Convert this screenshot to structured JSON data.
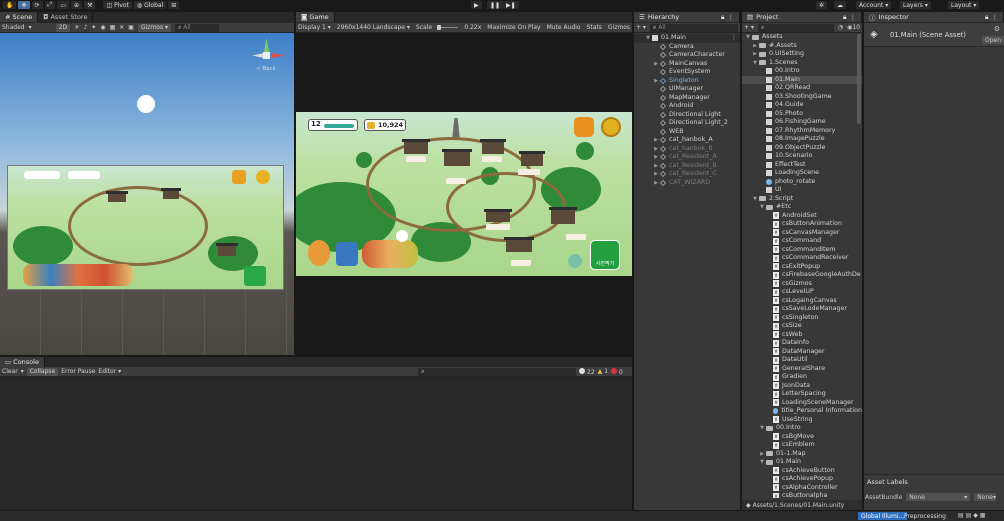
{
  "toolbar": {
    "pivot": "Pivot",
    "global": "Global",
    "account": "Account",
    "layers": "Layers",
    "layout": "Layout"
  },
  "scene_panel": {
    "tabs": [
      "Scene",
      "Asset Store"
    ],
    "shading": "Shaded",
    "mode_2d": "2D",
    "gizmos": "Gizmos",
    "search_placeholder": "All",
    "gizmo_label": "< Back"
  },
  "game_panel": {
    "tab": "Game",
    "display": "Display 1",
    "resolution": "2960x1440 Landscape",
    "scale_label": "Scale",
    "scale_value": "0.22x",
    "maximize": "Maximize On Play",
    "mute": "Mute Audio",
    "stats": "Stats",
    "gizmos": "Gizmos",
    "hud": {
      "level": "12",
      "gold": "10,924",
      "button": "사진찍기"
    }
  },
  "hierarchy": {
    "tab": "Hierarchy",
    "search_placeholder": "All",
    "root": "01.Main",
    "items": [
      {
        "label": "Camera",
        "dim": false,
        "expand": false
      },
      {
        "label": "CameraCharacter",
        "dim": false,
        "expand": false
      },
      {
        "label": "MainCanvas",
        "dim": false,
        "expand": true
      },
      {
        "label": "EventSystem",
        "dim": false,
        "expand": false
      },
      {
        "label": "Singleton",
        "dim": false,
        "expand": true,
        "blue": true
      },
      {
        "label": "UIManager",
        "dim": false,
        "expand": false
      },
      {
        "label": "MapManager",
        "dim": false,
        "expand": false
      },
      {
        "label": "Android",
        "dim": false,
        "expand": false
      },
      {
        "label": "Directional Light",
        "dim": false,
        "expand": false
      },
      {
        "label": "Directional Light_2",
        "dim": false,
        "expand": false
      },
      {
        "label": "WEB",
        "dim": false,
        "expand": false
      },
      {
        "label": "cat_hanbok_A",
        "dim": false,
        "expand": true
      },
      {
        "label": "cat_hanbok_B",
        "dim": true,
        "expand": true
      },
      {
        "label": "cat_Resident_A",
        "dim": true,
        "expand": true
      },
      {
        "label": "cat_Resident_B",
        "dim": true,
        "expand": true
      },
      {
        "label": "cat_Resident_C",
        "dim": true,
        "expand": true
      },
      {
        "label": "CAT_WIZARD",
        "dim": true,
        "expand": true
      }
    ]
  },
  "project": {
    "tab": "Project",
    "count": "10",
    "footer": "Assets/1.Scenes/01.Main.unity",
    "rows": [
      {
        "label": "Assets",
        "indent": 0,
        "type": "folder",
        "expand": "open"
      },
      {
        "label": "#.Assets",
        "indent": 1,
        "type": "folder",
        "expand": "closed"
      },
      {
        "label": "0.UISetting",
        "indent": 1,
        "type": "folder",
        "expand": "closed"
      },
      {
        "label": "1.Scenes",
        "indent": 1,
        "type": "folder",
        "expand": "open"
      },
      {
        "label": "00.Intro",
        "indent": 2,
        "type": "scene"
      },
      {
        "label": "01.Main",
        "indent": 2,
        "type": "scene",
        "selected": true
      },
      {
        "label": "02.QRRead",
        "indent": 2,
        "type": "scene"
      },
      {
        "label": "03.ShootingGame",
        "indent": 2,
        "type": "scene"
      },
      {
        "label": "04.Guide",
        "indent": 2,
        "type": "scene"
      },
      {
        "label": "05.Photo",
        "indent": 2,
        "type": "scene"
      },
      {
        "label": "06.FishingGame",
        "indent": 2,
        "type": "scene"
      },
      {
        "label": "07.RhythmMemory",
        "indent": 2,
        "type": "scene"
      },
      {
        "label": "08.ImagePuzzle",
        "indent": 2,
        "type": "scene"
      },
      {
        "label": "09.ObjectPuzzle",
        "indent": 2,
        "type": "scene"
      },
      {
        "label": "10.Scenario",
        "indent": 2,
        "type": "scene"
      },
      {
        "label": "EffectTest",
        "indent": 2,
        "type": "scene"
      },
      {
        "label": "LoadingScene",
        "indent": 2,
        "type": "scene"
      },
      {
        "label": "photo_rotate",
        "indent": 2,
        "type": "blue"
      },
      {
        "label": "UI",
        "indent": 2,
        "type": "scene"
      },
      {
        "label": "2.Script",
        "indent": 1,
        "type": "folder",
        "expand": "open"
      },
      {
        "label": "#Etc",
        "indent": 2,
        "type": "folder",
        "expand": "open"
      },
      {
        "label": "AndroidSet",
        "indent": 3,
        "type": "script"
      },
      {
        "label": "csButtonAnimation",
        "indent": 3,
        "type": "script"
      },
      {
        "label": "csCanvasManager",
        "indent": 3,
        "type": "script"
      },
      {
        "label": "csCommand",
        "indent": 3,
        "type": "script"
      },
      {
        "label": "csCommandItem",
        "indent": 3,
        "type": "script"
      },
      {
        "label": "csCommandReceiver",
        "indent": 3,
        "type": "script"
      },
      {
        "label": "csExitPopup",
        "indent": 3,
        "type": "script"
      },
      {
        "label": "csFirebaseGoogleAuthDe",
        "indent": 3,
        "type": "script"
      },
      {
        "label": "csGizmos",
        "indent": 3,
        "type": "script"
      },
      {
        "label": "csLevelUP",
        "indent": 3,
        "type": "script"
      },
      {
        "label": "csLogaingCanvas",
        "indent": 3,
        "type": "script"
      },
      {
        "label": "csSaveLodeManager",
        "indent": 3,
        "type": "script"
      },
      {
        "label": "csSingleton",
        "indent": 3,
        "type": "script"
      },
      {
        "label": "csSize",
        "indent": 3,
        "type": "script"
      },
      {
        "label": "csWeb",
        "indent": 3,
        "type": "script"
      },
      {
        "label": "DataInfo",
        "indent": 3,
        "type": "script"
      },
      {
        "label": "DataManager",
        "indent": 3,
        "type": "script"
      },
      {
        "label": "DataUtil",
        "indent": 3,
        "type": "script"
      },
      {
        "label": "GeneralShare",
        "indent": 3,
        "type": "script"
      },
      {
        "label": "Gradien",
        "indent": 3,
        "type": "script"
      },
      {
        "label": "JsonData",
        "indent": 3,
        "type": "script"
      },
      {
        "label": "LetterSpacing",
        "indent": 3,
        "type": "script"
      },
      {
        "label": "LoadingSceneManager",
        "indent": 3,
        "type": "script"
      },
      {
        "label": "title_Personal Information",
        "indent": 3,
        "type": "blue"
      },
      {
        "label": "UseString",
        "indent": 3,
        "type": "script"
      },
      {
        "label": "00.Intro",
        "indent": 2,
        "type": "folder",
        "expand": "open"
      },
      {
        "label": "csBgMove",
        "indent": 3,
        "type": "script"
      },
      {
        "label": "csEmblem",
        "indent": 3,
        "type": "script"
      },
      {
        "label": "01-1.Map",
        "indent": 2,
        "type": "folder",
        "expand": "closed"
      },
      {
        "label": "01.Main",
        "indent": 2,
        "type": "folder",
        "expand": "open"
      },
      {
        "label": "csAchieveButton",
        "indent": 3,
        "type": "script"
      },
      {
        "label": "csAchievePopup",
        "indent": 3,
        "type": "script"
      },
      {
        "label": "csAlphaController",
        "indent": 3,
        "type": "script"
      },
      {
        "label": "csButtonalpha",
        "indent": 3,
        "type": "script"
      }
    ]
  },
  "inspector": {
    "tab": "Inspector",
    "title": "01.Main (Scene Asset)",
    "open_button": "Open",
    "asset_labels": "Asset Labels",
    "asset_bundle_label": "AssetBundle",
    "asset_bundle_value": "None",
    "asset_bundle_variant": "None"
  },
  "console": {
    "tab": "Console",
    "clear": "Clear",
    "collapse": "Collapse",
    "error_pause": "Error Pause",
    "editor": "Editor",
    "log_count": "22",
    "warn_count": "1",
    "error_count": "0"
  },
  "status": {
    "global_illum": "Global Illumi...",
    "preprocessing": "Preprocessing"
  },
  "colors": {
    "selection": "#4d4d4d",
    "accent_blue": "#2f6fbf",
    "warn": "#e8c33a"
  }
}
